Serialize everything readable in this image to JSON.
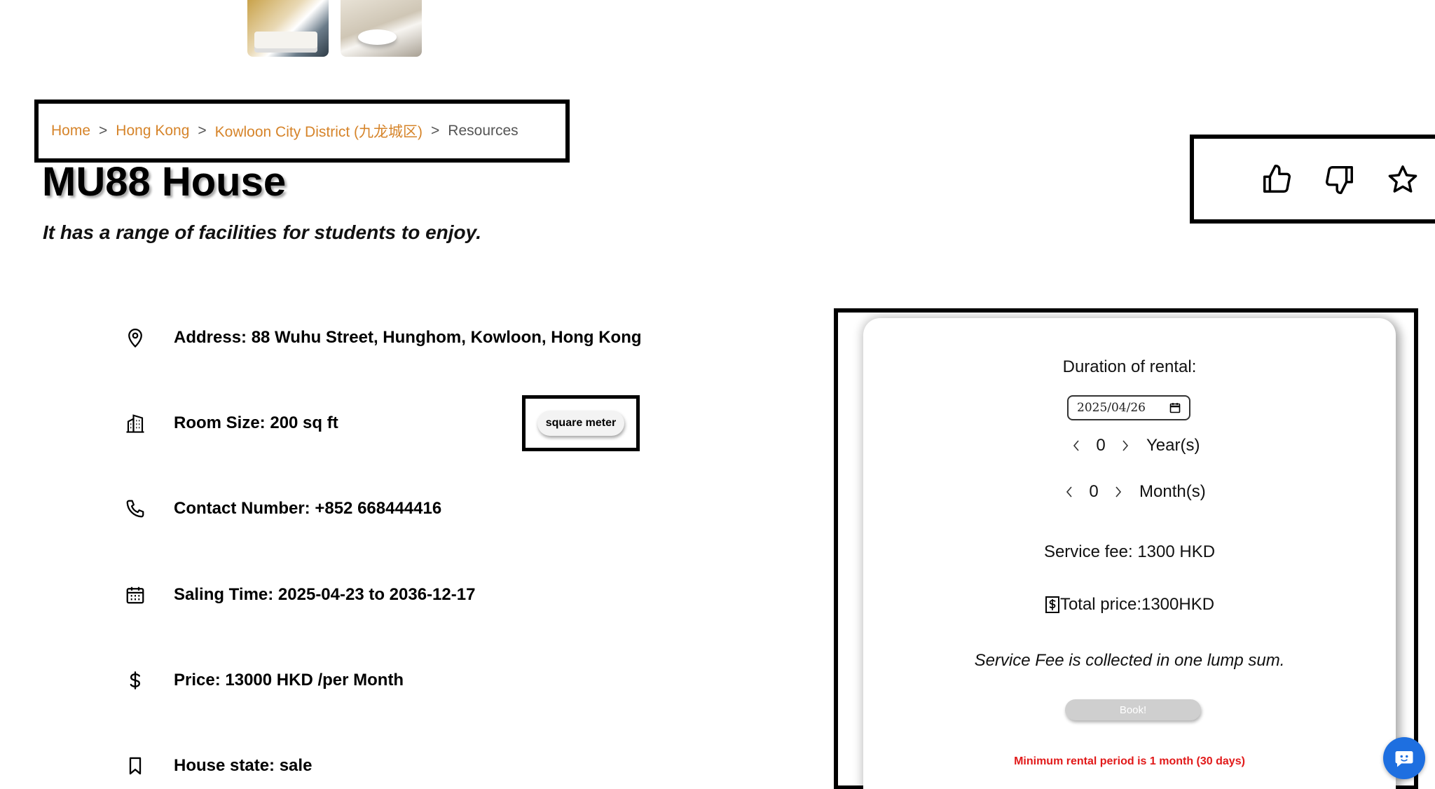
{
  "breadcrumb": {
    "home": "Home",
    "city": "Hong Kong",
    "district": "Kowloon City District (九龙城区)",
    "current": "Resources",
    "separator": ">"
  },
  "listing": {
    "title": "MU88 House",
    "subtitle": "It has a range of facilities for students to enjoy."
  },
  "details": {
    "address": "Address: 88 Wuhu Street, Hunghom, Kowloon, Hong Kong",
    "room_size": "Room Size: 200 sq ft",
    "contact": "Contact Number: +852 668444416",
    "saling_time": "Saling Time: 2025-04-23 to 2036-12-17",
    "price": "Price: 13000 HKD /per Month",
    "house_state": "House state: sale"
  },
  "unit_toggle_label": "square meter",
  "booking": {
    "duration_label": "Duration of rental:",
    "date_value": "2025/04/26",
    "years_value": "0",
    "years_unit": "Year(s)",
    "months_value": "0",
    "months_unit": "Month(s)",
    "service_fee": "Service fee: 1300 HKD",
    "total_price": "Total price:1300HKD",
    "fee_note": "Service Fee is collected in one lump sum.",
    "book_label": "Book!",
    "min_warning": "Minimum rental period is 1 month (30 days)"
  },
  "icons": {
    "reactions": [
      "thumbs-up-icon",
      "thumbs-down-icon",
      "star-icon"
    ],
    "details": [
      "map-pin-icon",
      "building-icon",
      "phone-icon",
      "calendar-icon",
      "dollar-icon",
      "bookmark-icon"
    ]
  },
  "colors": {
    "breadcrumb_link": "#d6842a",
    "warning": "#e11919",
    "book_button": "#cfcfcf",
    "chat_button": "#1e6fe0"
  }
}
